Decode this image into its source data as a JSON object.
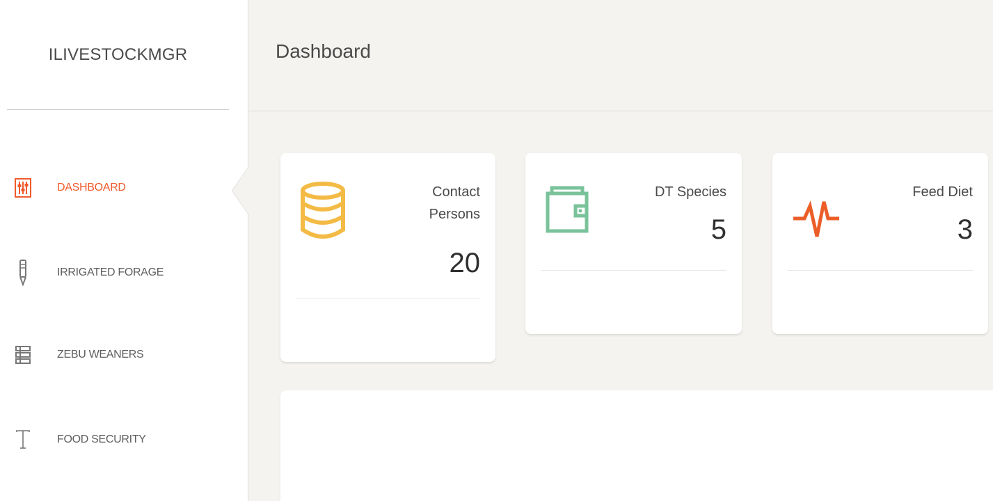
{
  "brand": {
    "name": "ILIVESTOCKMGR"
  },
  "sidebar": {
    "items": [
      {
        "label": "DASHBOARD",
        "icon": "sliders-icon",
        "active": true
      },
      {
        "label": "IRRIGATED FORAGE",
        "icon": "pencil-icon",
        "active": false
      },
      {
        "label": "ZEBU WEANERS",
        "icon": "list-icon",
        "active": false
      },
      {
        "label": "FOOD SECURITY",
        "icon": "type-icon",
        "active": false
      }
    ]
  },
  "header": {
    "title": "Dashboard"
  },
  "cards": [
    {
      "label": "Contact Persons",
      "value": "20",
      "icon": "database-icon",
      "color": "#f3bb45"
    },
    {
      "label": "DT Species",
      "value": "5",
      "icon": "wallet-icon",
      "color": "#7ac29a"
    },
    {
      "label": "Feed Diet",
      "value": "3",
      "icon": "pulse-icon",
      "color": "#eb5e28"
    }
  ],
  "colors": {
    "accent": "#ef5a2b",
    "background": "#f4f3ef",
    "sidebar_text": "#5d5d5d"
  }
}
